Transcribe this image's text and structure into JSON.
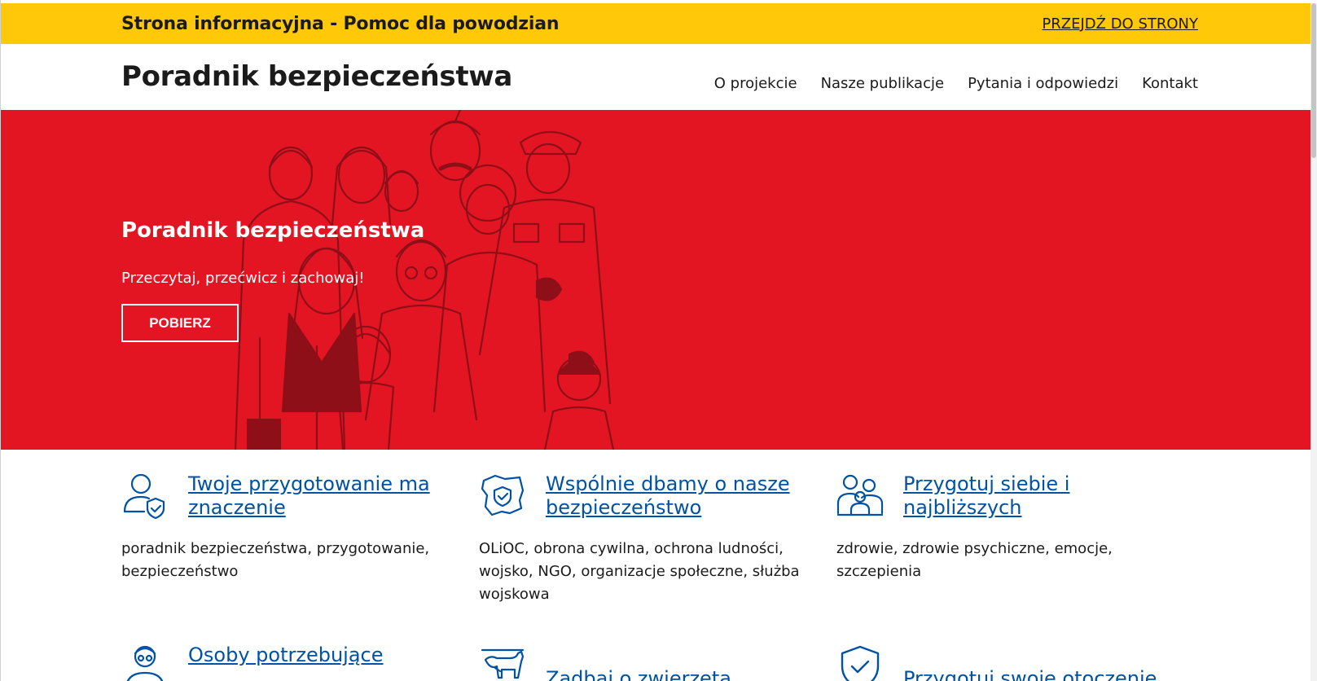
{
  "topbar": {
    "title": "Strona informacyjna - Pomoc dla powodzian",
    "link_label": "PRZEJDŹ DO STRONY"
  },
  "header": {
    "logo": "Poradnik bezpieczeństwa",
    "nav": [
      "O projekcie",
      "Nasze publikacje",
      "Pytania i odpowiedzi",
      "Kontakt"
    ]
  },
  "hero": {
    "title": "Poradnik bezpieczeństwa",
    "subtitle": "Przeczytaj, przećwicz i zachowaj!",
    "button": "POBIERZ",
    "background": "#e41523"
  },
  "cards": [
    {
      "icon": "person-shield-icon",
      "title": "Twoje przygotowanie ma znaczenie",
      "description": "poradnik bezpieczeństwa, przygotowanie, bezpieczeństwo"
    },
    {
      "icon": "poland-map-shield-icon",
      "title": "Wspólnie dbamy o nasze bezpieczeństwo",
      "description": "OLiOC, obrona cywilna, ochrona ludności, wojsko, NGO, organizacje społeczne, służba wojskowa"
    },
    {
      "icon": "family-icon",
      "title": "Przygotuj siebie i najbliższych",
      "description": "zdrowie, zdrowie psychiczne, emocje, szczepienia"
    },
    {
      "icon": "elderly-person-icon",
      "title": "Osoby potrzebujące",
      "description": ""
    },
    {
      "icon": "cow-icon",
      "title": "Zadbaj o zwierzęta",
      "description": ""
    },
    {
      "icon": "shield-check-icon",
      "title": "Przygotuj swoje otoczenie",
      "description": ""
    }
  ],
  "colors": {
    "topbar": "#ffc90a",
    "hero": "#e41523",
    "link": "#0052a5"
  }
}
